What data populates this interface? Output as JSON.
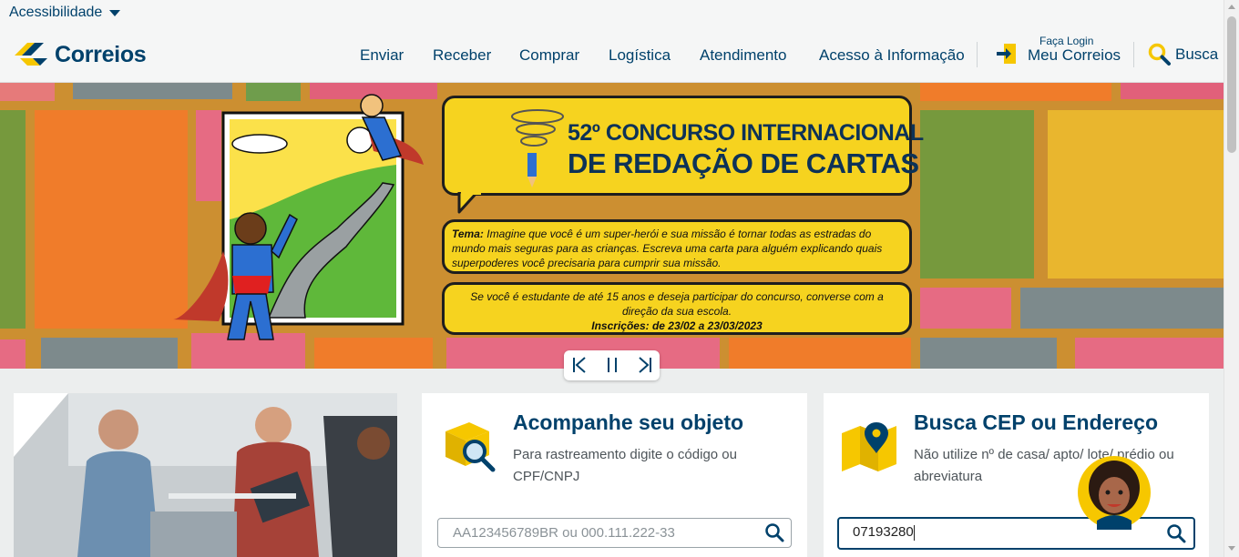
{
  "topbar": {
    "accessibility_label": "Acessibilidade"
  },
  "header": {
    "logo_text": "Correios",
    "nav": [
      "Enviar",
      "Receber",
      "Comprar",
      "Logística",
      "Atendimento",
      "Acesso à Informação"
    ],
    "login_small": "Faça Login",
    "login_big": "Meu Correios",
    "search_label": "Busca"
  },
  "banner": {
    "title_line1": "52º CONCURSO INTERNACIONAL",
    "title_line2": "DE REDAÇÃO DE CARTAS",
    "tema_label": "Tema:",
    "tema_text": "Imagine que você é um super-herói e sua missão é tornar todas as estradas do mundo mais seguras para as crianças. Escreva uma carta para alguém explicando quais superpoderes você precisaria para cumprir sua missão.",
    "info_text": "Se você é estudante de até 15 anos e deseja participar do concurso, converse com a direção da sua escola.",
    "inscricoes": "Inscrições: de 23/02 a 23/03/2023"
  },
  "tracking": {
    "title": "Acompanhe seu objeto",
    "desc": "Para rastreamento digite o código ou CPF/CNPJ",
    "placeholder": "AA123456789BR ou 000.111.222-33"
  },
  "cep": {
    "title": "Busca CEP ou Endereço",
    "desc": "Não utilize nº de casa/ apto/ lote/ prédio ou abreviatura",
    "value": "07193280"
  },
  "colors": {
    "brand_blue": "#00416b",
    "brand_yellow": "#f6c700",
    "banner_yellow": "#f6d31f"
  }
}
